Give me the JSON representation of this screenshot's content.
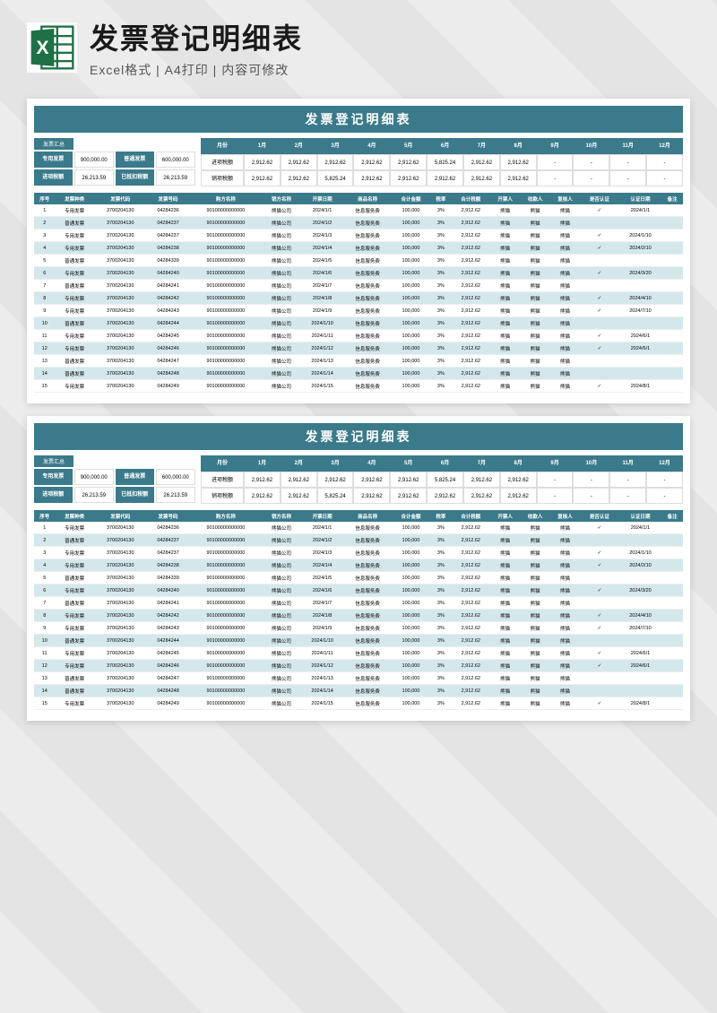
{
  "header": {
    "title": "发票登记明细表",
    "subtitle": "Excel格式 | A4打印 | 内容可修改",
    "icon_label": "X"
  },
  "sheet": {
    "title": "发票登记明细表",
    "summary": {
      "tag": "发票汇总",
      "r1": [
        {
          "l": "专用发票",
          "v": "900,000.00"
        },
        {
          "l": "普通发票",
          "v": "600,000.00"
        }
      ],
      "r2": [
        {
          "l": "进项税额",
          "v": "26,213.59"
        },
        {
          "l": "已抵扣税额",
          "v": "26,213.59"
        }
      ]
    },
    "months": {
      "head": "月份",
      "labels": [
        "1月",
        "2月",
        "3月",
        "4月",
        "5月",
        "6月",
        "7月",
        "8月",
        "9月",
        "10月",
        "11月",
        "12月"
      ],
      "rows": [
        {
          "l": "进项税额",
          "v": [
            "2,912.62",
            "2,912.62",
            "2,912.62",
            "2,912.62",
            "2,912.62",
            "5,825.24",
            "2,912.62",
            "2,912.62",
            "-",
            "-",
            "-",
            "-"
          ]
        },
        {
          "l": "销项税额",
          "v": [
            "2,912.62",
            "2,912.62",
            "5,825.24",
            "2,912.62",
            "2,912.62",
            "2,912.62",
            "2,912.62",
            "2,912.62",
            "-",
            "-",
            "-",
            "-"
          ]
        }
      ]
    },
    "cols": [
      "序号",
      "发票种类",
      "发票代码",
      "发票号码",
      "购方名称",
      "销方名称",
      "开票日期",
      "商品名称",
      "合计金额",
      "税率",
      "合计税额",
      "开票人",
      "收款人",
      "复核人",
      "是否认证",
      "认证日期",
      "备注"
    ],
    "rows": [
      [
        "1",
        "专用发票",
        "3700204130",
        "04284236",
        "90100000000000",
        "熊猫公司",
        "2024/1/1",
        "信息服务费",
        "100,000",
        "3%",
        "2,912.62",
        "熊猫",
        "熊猫",
        "熊猫",
        "✓",
        "2024/1/1",
        ""
      ],
      [
        "2",
        "普通发票",
        "3700204130",
        "04284237",
        "90100000000000",
        "熊猫公司",
        "2024/1/2",
        "信息服务费",
        "100,000",
        "3%",
        "2,912.62",
        "熊猫",
        "熊猫",
        "熊猫",
        "",
        "",
        ""
      ],
      [
        "3",
        "专用发票",
        "3700204130",
        "04284237",
        "90100000000000",
        "熊猫公司",
        "2024/1/3",
        "信息服务费",
        "100,000",
        "3%",
        "2,912.62",
        "熊猫",
        "熊猫",
        "熊猫",
        "✓",
        "2024/1/10",
        ""
      ],
      [
        "4",
        "专用发票",
        "3700204130",
        "04284238",
        "90100000000000",
        "熊猫公司",
        "2024/1/4",
        "信息服务费",
        "100,000",
        "3%",
        "2,912.62",
        "熊猫",
        "熊猫",
        "熊猫",
        "✓",
        "2024/2/10",
        ""
      ],
      [
        "5",
        "普通发票",
        "3700204130",
        "04284339",
        "90100000000000",
        "熊猫公司",
        "2024/1/5",
        "信息服务费",
        "100,000",
        "3%",
        "2,912.62",
        "熊猫",
        "熊猫",
        "熊猫",
        "",
        "",
        ""
      ],
      [
        "6",
        "专用发票",
        "3700204130",
        "04284240",
        "90100000000000",
        "熊猫公司",
        "2024/1/6",
        "信息服务费",
        "100,000",
        "3%",
        "2,912.62",
        "熊猫",
        "熊猫",
        "熊猫",
        "✓",
        "2024/3/20",
        ""
      ],
      [
        "7",
        "普通发票",
        "3700204130",
        "04284241",
        "90100000000000",
        "熊猫公司",
        "2024/1/7",
        "信息服务费",
        "100,000",
        "3%",
        "2,912.62",
        "熊猫",
        "熊猫",
        "熊猫",
        "",
        "",
        ""
      ],
      [
        "8",
        "专用发票",
        "3700204130",
        "04284242",
        "90100000000000",
        "熊猫公司",
        "2024/1/8",
        "信息服务费",
        "100,000",
        "3%",
        "2,912.62",
        "熊猫",
        "熊猫",
        "熊猫",
        "✓",
        "2024/4/10",
        ""
      ],
      [
        "9",
        "专用发票",
        "3700204130",
        "04284243",
        "90100000000000",
        "熊猫公司",
        "2024/1/9",
        "信息服务费",
        "100,000",
        "3%",
        "2,912.62",
        "熊猫",
        "熊猫",
        "熊猫",
        "✓",
        "2024/7/10",
        ""
      ],
      [
        "10",
        "普通发票",
        "3700204130",
        "04284244",
        "90100000000000",
        "熊猫公司",
        "2024/1/10",
        "信息服务费",
        "100,000",
        "3%",
        "2,912.62",
        "熊猫",
        "熊猫",
        "熊猫",
        "",
        "",
        ""
      ],
      [
        "11",
        "专用发票",
        "3700204130",
        "04284245",
        "90100000000000",
        "熊猫公司",
        "2024/1/11",
        "信息服务费",
        "100,000",
        "3%",
        "2,912.62",
        "熊猫",
        "熊猫",
        "熊猫",
        "✓",
        "2024/6/1",
        ""
      ],
      [
        "12",
        "专用发票",
        "3700204130",
        "04284246",
        "90100000000000",
        "熊猫公司",
        "2024/1/12",
        "信息服务费",
        "100,000",
        "3%",
        "2,912.62",
        "熊猫",
        "熊猫",
        "熊猫",
        "✓",
        "2024/6/1",
        ""
      ],
      [
        "13",
        "普通发票",
        "3700204130",
        "04284247",
        "90100000000000",
        "熊猫公司",
        "2024/1/13",
        "信息服务费",
        "100,000",
        "3%",
        "2,912.62",
        "熊猫",
        "熊猫",
        "熊猫",
        "",
        "",
        ""
      ],
      [
        "14",
        "普通发票",
        "3700204130",
        "04284248",
        "90100000000000",
        "熊猫公司",
        "2024/1/14",
        "信息服务费",
        "100,000",
        "3%",
        "2,912.62",
        "熊猫",
        "熊猫",
        "熊猫",
        "",
        "",
        ""
      ],
      [
        "15",
        "专用发票",
        "3700204130",
        "04284249",
        "90100000000000",
        "熊猫公司",
        "2024/1/15",
        "信息服务费",
        "100,000",
        "3%",
        "2,912.62",
        "熊猫",
        "熊猫",
        "熊猫",
        "✓",
        "2024/8/1",
        ""
      ]
    ]
  }
}
